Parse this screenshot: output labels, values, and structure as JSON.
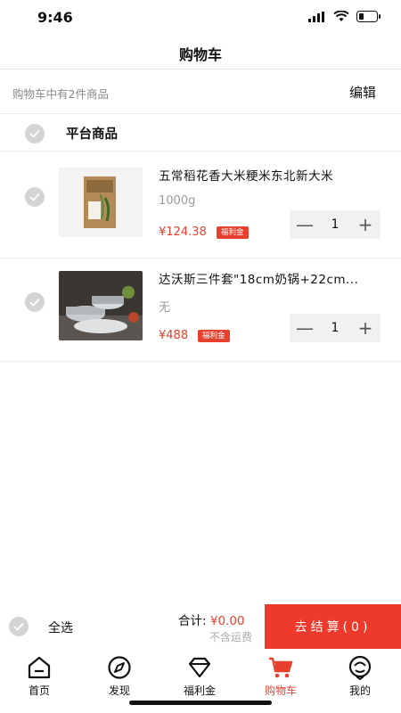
{
  "status_bar": {
    "time": "9:46"
  },
  "nav": {
    "title": "购物车"
  },
  "summary": {
    "text": "购物车中有2件商品",
    "edit_label": "编辑"
  },
  "section": {
    "title": "平台商品"
  },
  "items": [
    {
      "name": "五常稻花香大米粳米东北新大米",
      "spec": "1000g",
      "price": "¥124.38",
      "badge": "福利金",
      "quantity": "1",
      "minus": "—",
      "plus": "+"
    },
    {
      "name": "达沃斯三件套\"18cm奶锅+22cm...",
      "spec": "无",
      "price": "¥488",
      "badge": "福利金",
      "quantity": "1",
      "minus": "—",
      "plus": "+"
    }
  ],
  "checkout": {
    "select_all_label": "全选",
    "total_label": "合计:",
    "total_value": "¥0.00",
    "shipping_note": "不含运费",
    "button_label": "去结算(0)"
  },
  "tabs": [
    {
      "label": "首页",
      "icon": "home-icon"
    },
    {
      "label": "发现",
      "icon": "compass-icon"
    },
    {
      "label": "福利金",
      "icon": "diamond-icon"
    },
    {
      "label": "购物车",
      "icon": "cart-icon",
      "active": true
    },
    {
      "label": "我的",
      "icon": "profile-icon"
    }
  ],
  "colors": {
    "accent": "#e8402e",
    "checkout_button": "#ee3a2c",
    "check_circle": "#d4d4d4"
  }
}
